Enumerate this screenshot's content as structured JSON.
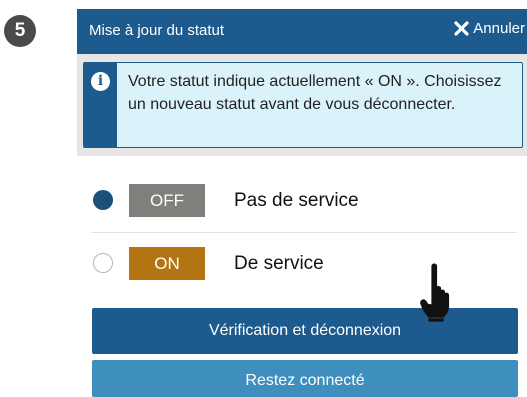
{
  "step_number": "5",
  "dialog": {
    "title": "Mise à jour du statut",
    "cancel_label": "Annuler",
    "cancel_icon": "close-x-icon",
    "colors": {
      "header": "#1d5a8e",
      "info_background": "#daf3fb",
      "primary_button": "#1d5a8e",
      "secondary_button": "#3e8fbd",
      "off_badge": "#7f7f7b",
      "on_badge": "#b37512"
    }
  },
  "info": {
    "icon": "info-circle-icon",
    "message": "Votre statut indique actuellement « ON ». Choisissez un nouveau statut avant de vous déconnecter."
  },
  "options": [
    {
      "badge": "OFF",
      "label": "Pas de service",
      "selected": true
    },
    {
      "badge": "ON",
      "label": "De service",
      "selected": false
    }
  ],
  "actions": {
    "primary_label": "Vérification et déconnexion",
    "secondary_label": "Restez connecté"
  },
  "pointer": "hand-pointer-icon"
}
